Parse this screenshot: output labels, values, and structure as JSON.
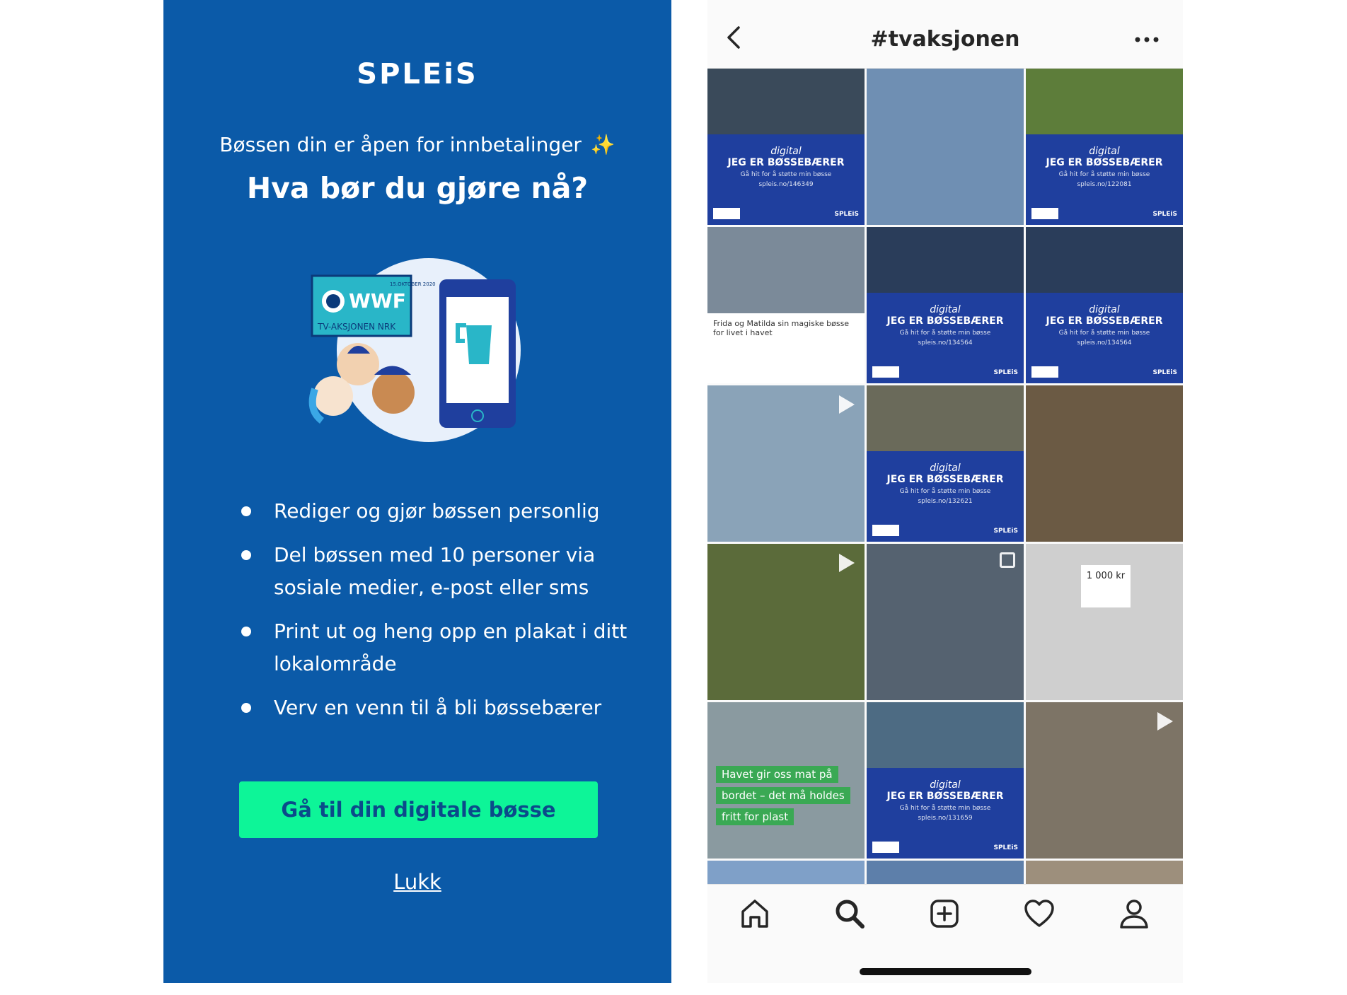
{
  "left": {
    "logo": "SPLEiS",
    "subtitle": "Bøssen din er åpen for innbetalinger",
    "sparkle": "✨",
    "heading": "Hva bør du gjøre nå?",
    "illustration": {
      "poster_date": "15.OKTOBER 2020",
      "poster_brand": "WWF",
      "poster_sub": "TV-AKSJONEN NRK"
    },
    "bullets": [
      "Rediger og gjør bøssen personlig",
      "Del bøssen med 10 personer via sosiale medier, e-post eller sms",
      "Print ut og heng opp en plakat i ditt lokalområde",
      "Verv en venn til å bli bøssebærer"
    ],
    "cta_label": "Gå til din digitale bøsse",
    "close_label": "Lukk"
  },
  "phone": {
    "title": "#tvaksjonen",
    "tiles": [
      {
        "bg": "#3a4a5a",
        "overlay": true,
        "caption": "JEG ER BØSSEBÆRER",
        "url": "spleis.no/146349"
      },
      {
        "bg": "#6f8fb3",
        "overlay": false
      },
      {
        "bg": "#5d7d3a",
        "overlay": true,
        "caption": "JEG ER BØSSEBÆRER",
        "url": "spleis.no/122081"
      },
      {
        "bg": "#7b8a99",
        "overlay": false,
        "card": "Frida og Matilda sin magiske bøsse for livet i havet"
      },
      {
        "bg": "#2a3d5a",
        "overlay": true,
        "caption": "JEG ER BØSSEBÆRER",
        "url": "spleis.no/134564"
      },
      {
        "bg": "#2a3d5a",
        "overlay": true,
        "caption": "JEG ER BØSSEBÆRER",
        "url": "spleis.no/134564"
      },
      {
        "bg": "#8aa3b8",
        "overlay": false,
        "video": true
      },
      {
        "bg": "#6a6a5a",
        "overlay": true,
        "caption": "JEG ER BØSSEBÆRER",
        "url": "spleis.no/132621"
      },
      {
        "bg": "#6b5a44",
        "overlay": false
      },
      {
        "bg": "#5b6b3a",
        "overlay": false,
        "video": true
      },
      {
        "bg": "#556270",
        "overlay": false,
        "multi": true
      },
      {
        "bg": "#cfcfcf",
        "overlay": false,
        "amount": "1 000 kr"
      },
      {
        "bg": "#8a9aa0",
        "overlay": false,
        "green": [
          "Havet gir oss mat på",
          "bordet – det må holdes",
          "fritt for plast"
        ]
      },
      {
        "bg": "#4d6b83",
        "overlay": true,
        "caption": "JEG ER BØSSEBÆRER",
        "url": "spleis.no/131659"
      },
      {
        "bg": "#7d7466",
        "overlay": false,
        "video": true
      },
      {
        "bg": "#7fa0c8",
        "overlay": false,
        "short": true
      },
      {
        "bg": "#5d7faa",
        "overlay": false,
        "short": true
      },
      {
        "bg": "#9d8f7c",
        "overlay": false,
        "short": true
      }
    ],
    "overlay_script": "digital",
    "overlay_sub": "Gå hit for å støtte min bøsse"
  }
}
